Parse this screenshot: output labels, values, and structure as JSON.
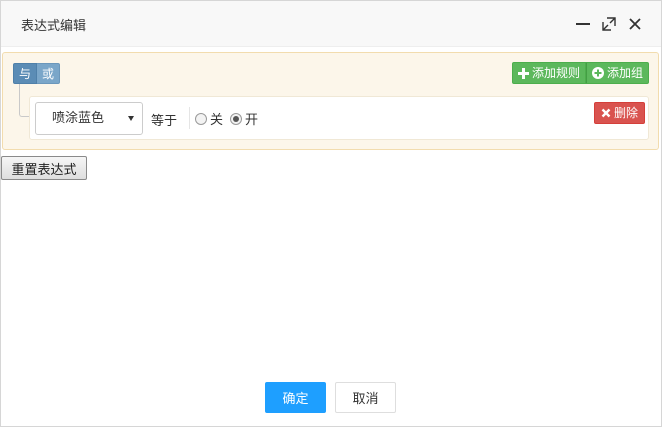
{
  "dialog": {
    "title": "表达式编辑",
    "controls": {
      "minimize": "minimize-icon",
      "maximize": "maximize-icon",
      "close": "close-icon"
    }
  },
  "logic": {
    "and_label": "与",
    "or_label": "或",
    "selected": "and"
  },
  "actions": {
    "add_rule_label": "添加规则",
    "add_group_label": "添加组",
    "delete_label": "删除"
  },
  "rule": {
    "field_value": "喷涂蓝色",
    "operator": "等于",
    "options": [
      {
        "label": "关",
        "checked": false
      },
      {
        "label": "开",
        "checked": true
      }
    ]
  },
  "reset_label": "重置表达式",
  "footer": {
    "ok_label": "确定",
    "cancel_label": "取消"
  },
  "colors": {
    "primary": "#1e9fff",
    "success": "#5cb85c",
    "danger": "#d9534f",
    "logic": "#7aa6c9",
    "panel_bg": "#fcf6ea"
  }
}
